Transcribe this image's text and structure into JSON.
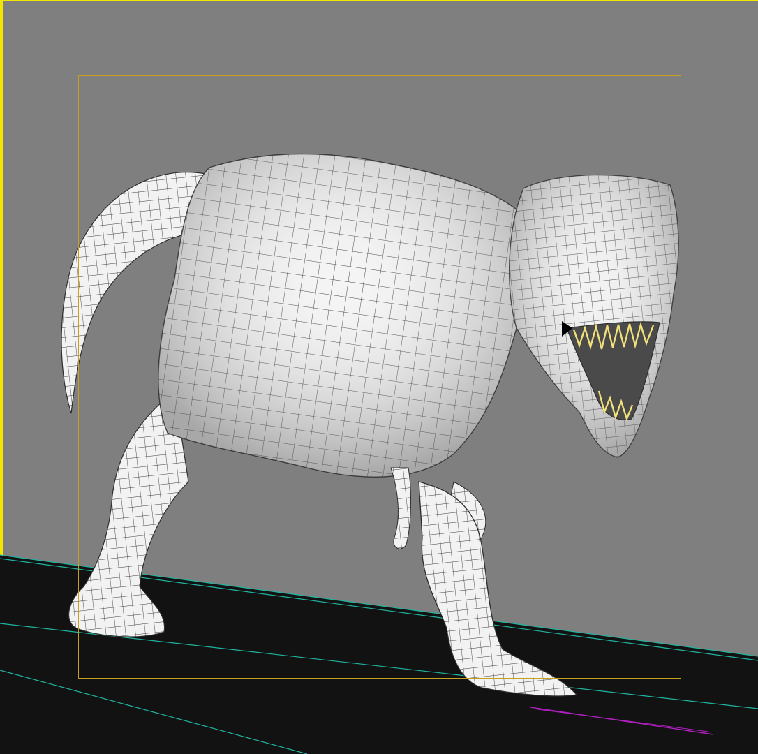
{
  "viewport": {
    "background_color": "#7f7f7f",
    "ground_color": "#121212",
    "active_border_color": "#f2e600",
    "safe_frame_color": "#c8a020",
    "grid_line_color": "#1fb5a0",
    "axis_line_color": "#b020c0",
    "model_fill_color": "#f4f4f4",
    "wire_color": "#3a3a3a",
    "teeth_color": "#f2e07a"
  },
  "model": {
    "icon": "t-rex-wireframe-model"
  }
}
